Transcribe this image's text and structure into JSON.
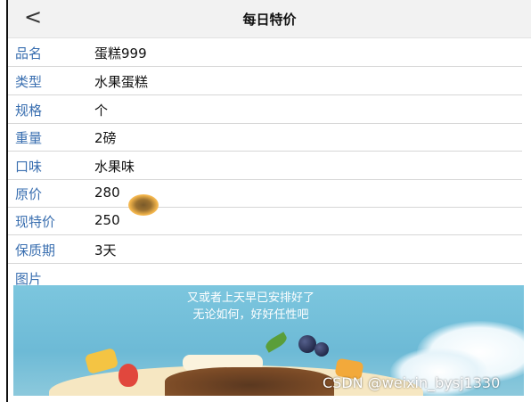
{
  "header": {
    "title": "每日特价",
    "back_icon": "chevron-left-icon"
  },
  "fields": [
    {
      "label": "品名",
      "value": "蛋糕999"
    },
    {
      "label": "类型",
      "value": "水果蛋糕"
    },
    {
      "label": "规格",
      "value": "个"
    },
    {
      "label": "重量",
      "value": "2磅"
    },
    {
      "label": "口味",
      "value": "水果味"
    },
    {
      "label": "原价",
      "value": "280"
    },
    {
      "label": "现特价",
      "value": "250"
    },
    {
      "label": "保质期",
      "value": "3天"
    }
  ],
  "image_section": {
    "label": "图片",
    "banner_text_1": "又或者上天早已安排好了",
    "banner_text_2": "无论如何，好好任性吧"
  },
  "watermark": "CSDN @weixin_bysj1330",
  "colors": {
    "label": "#3a6fb0",
    "header_bg": "#f2f2f2"
  }
}
